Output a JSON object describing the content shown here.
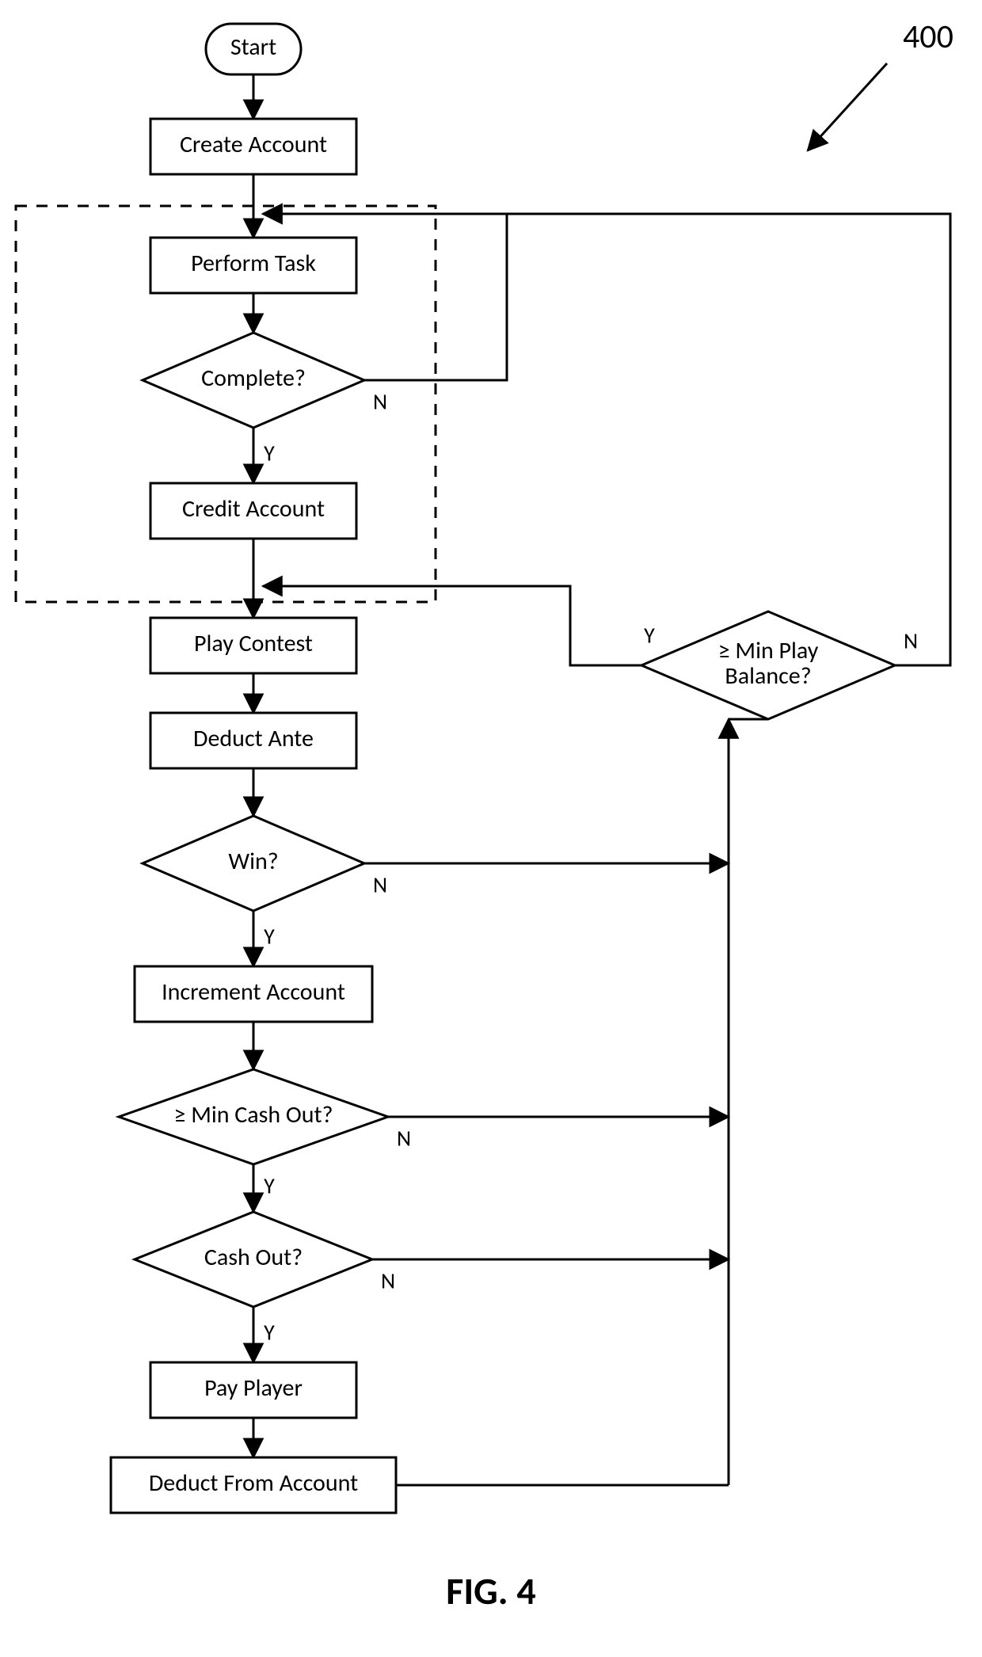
{
  "figure_ref": "400",
  "caption": "FIG. 4",
  "nodes": {
    "start": "Start",
    "create_account": "Create Account",
    "perform_task": "Perform Task",
    "complete": "Complete?",
    "credit_account": "Credit Account",
    "play_contest": "Play Contest",
    "deduct_ante": "Deduct Ante",
    "win": "Win?",
    "increment_account": "Increment Account",
    "min_cash_out": "≥ Min Cash Out?",
    "cash_out": "Cash Out?",
    "pay_player": "Pay Player",
    "deduct_from_acct": "Deduct From Account",
    "min_play_balance": "≥ Min Play\nBalance?"
  },
  "edge_labels": {
    "yes": "Y",
    "no": "N"
  },
  "layout_notes": {
    "dashed_group_covers": [
      "perform_task",
      "complete",
      "credit_account"
    ]
  }
}
